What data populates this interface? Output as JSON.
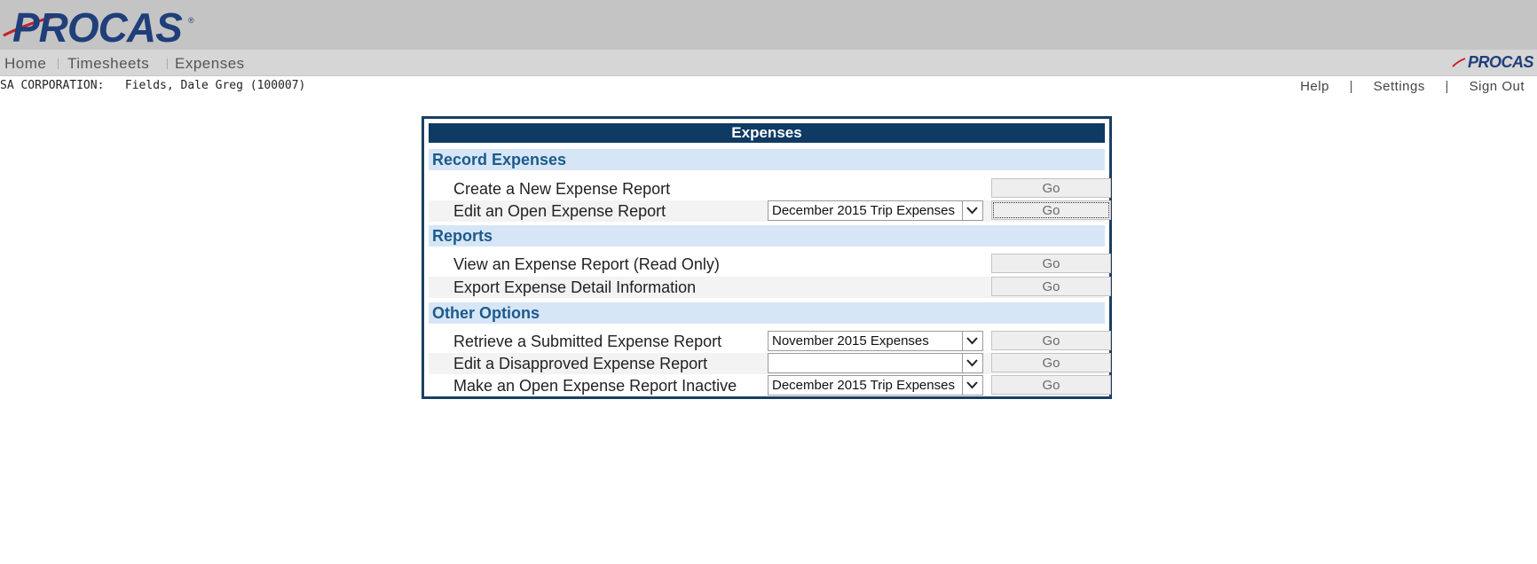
{
  "brand": {
    "logo_text": "PROCAS",
    "reg_mark": "®",
    "nav_logo_text": "PROCAS"
  },
  "nav": {
    "items": [
      {
        "label": "Home"
      },
      {
        "label": "Timesheets"
      },
      {
        "label": "Expenses"
      }
    ]
  },
  "user": {
    "company": "SA CORPORATION:",
    "name": "Fields, Dale Greg (100007)"
  },
  "toplinks": {
    "help": "Help",
    "settings": "Settings",
    "sign_out": "Sign Out",
    "separator": "|"
  },
  "panel": {
    "title": "Expenses",
    "go_label": "Go",
    "sections": {
      "record": {
        "title": "Record Expenses",
        "create_label": "Create a New Expense Report",
        "edit_label": "Edit an Open Expense Report",
        "edit_select_value": "December 2015 Trip Expenses"
      },
      "reports": {
        "title": "Reports",
        "view_label": "View an Expense Report (Read Only)",
        "export_label": "Export Expense Detail Information"
      },
      "other": {
        "title": "Other Options",
        "retrieve_label": "Retrieve a Submitted Expense Report",
        "retrieve_select_value": "November 2015 Expenses",
        "disapproved_label": "Edit a Disapproved Expense Report",
        "disapproved_select_value": "",
        "inactive_label": "Make an Open Expense Report Inactive",
        "inactive_select_value": "December 2015 Trip Expenses"
      }
    }
  },
  "colors": {
    "banner": "#c4c4c4",
    "navbar": "#d6d6d6",
    "panel_border": "#1b3f63",
    "panel_title_bg": "#0f3a63",
    "section_bg": "#d7e6f6",
    "section_text": "#1d5a8c",
    "logo_blue": "#1f3f7a",
    "logo_red": "#c8202a"
  }
}
